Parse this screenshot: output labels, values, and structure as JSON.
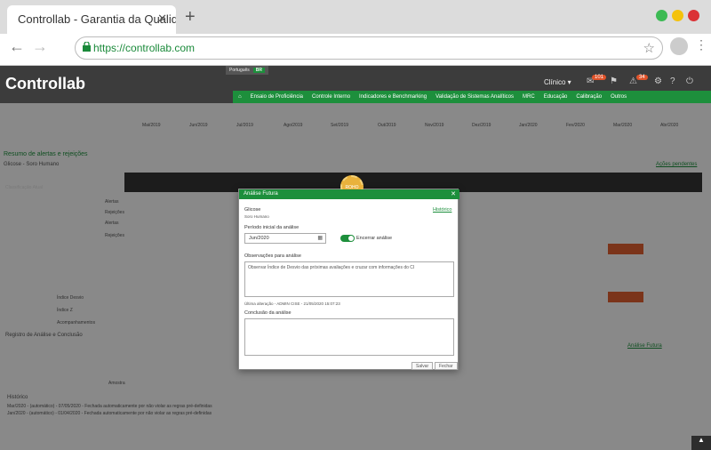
{
  "browser": {
    "tab_title": "Controllab - Garantia da Qualid",
    "tab_close": "✕",
    "new_tab": "+",
    "url": "https://controllab.com",
    "back": "←",
    "forward": "→",
    "star": "☆",
    "menu": "⋮",
    "dot_colors": [
      "#3cba54",
      "#f4c20d",
      "#db3236"
    ]
  },
  "app": {
    "logo": "Controllab",
    "language": "Português",
    "language_code": "BR",
    "profile": "Clínico",
    "badge_messages": "101",
    "badge_alerts": "34",
    "menu": [
      "Ensaio de Proficiência",
      "Controle Interno",
      "Indicadores e Benchmarking",
      "Validação de Sistemas Analíticos",
      "MRC",
      "Educação",
      "Calibração",
      "Outros"
    ]
  },
  "background": {
    "months": [
      "Mai/2019",
      "Jun/2019",
      "Jul/2019",
      "Ago/2019",
      "Set/2019",
      "Out/2019",
      "Nov/2019",
      "Dez/2019",
      "Jan/2020",
      "Fev/2020",
      "Mar/2020",
      "Abr/2020"
    ],
    "section_title": "Resumo de alertas e rejeições",
    "analyte": "Glicose - Soro Humano",
    "pending_link": "Ações pendentes",
    "class_header": "Classificação Atual",
    "row_labels": [
      "Alertas",
      "Rejeições",
      "Alertas",
      "Rejeições",
      "Índice Desvio",
      "Índice Z",
      "Acompanhamentos"
    ],
    "register_title": "Registro de Análise e Conclusão",
    "historico": "Histórico",
    "hist_1": "Mar/2020 - (automático) - 07/05/2020 - Fechada automaticamente por não violar as regras pré-definidas",
    "hist_2": "Jan/2020 - (automático) - 01/04/2020 - Fechada automaticamente por não violar as regras pré-definidas",
    "analise_futura_link": "Análise Futura",
    "amostra": "Amostra"
  },
  "modal": {
    "title": "Análise Futura",
    "close": "✕",
    "seal": "ROHO",
    "analyte": "Glicose",
    "matrix": "Soro Humano",
    "history_link": "Histórico",
    "period_label": "Período inicial da análise",
    "period_value": "Jun/2020",
    "toggle_label": "Encerrar análise",
    "obs_label": "Observações para análise",
    "obs_value": "Observar Índice de Desvio das próximas avaliações e cruzar com informações do CI",
    "last_change": "Última alteração - ADMIN CISE - 21/05/2020 15:07:23",
    "conclusion_label": "Conclusão da análise",
    "conclusion_value": "",
    "save": "Salvar",
    "close_btn": "Fechar"
  }
}
